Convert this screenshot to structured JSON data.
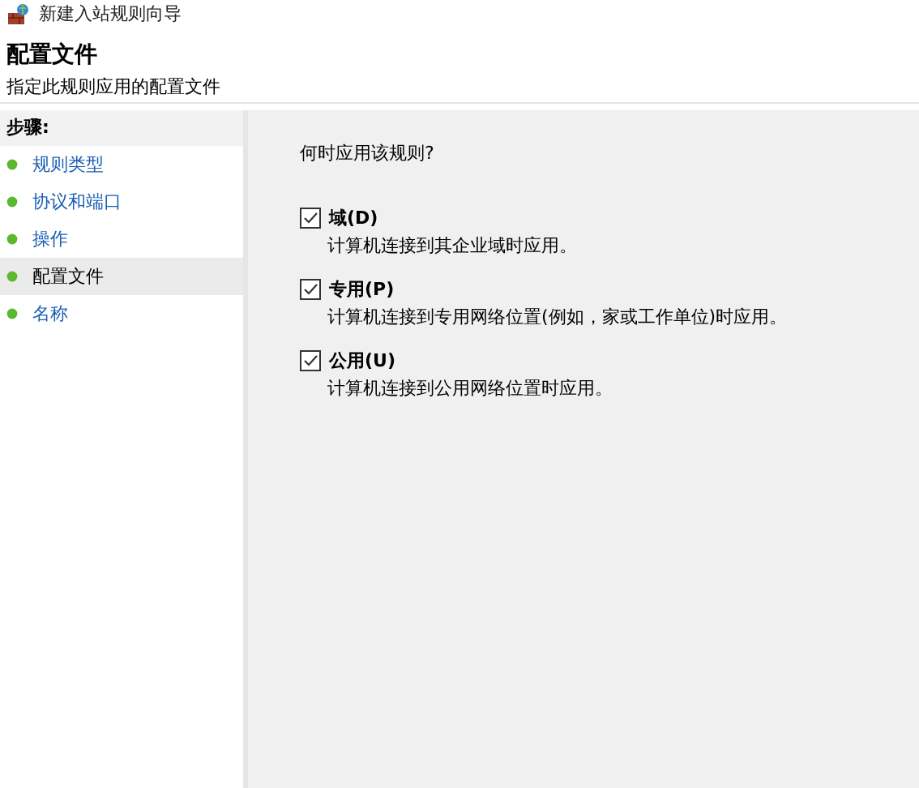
{
  "window": {
    "title": "新建入站规则向导"
  },
  "header": {
    "title": "配置文件",
    "subtitle": "指定此规则应用的配置文件"
  },
  "steps": {
    "heading": "步骤:",
    "items": [
      {
        "label": "规则类型",
        "selected": false
      },
      {
        "label": "协议和端口",
        "selected": false
      },
      {
        "label": "操作",
        "selected": false
      },
      {
        "label": "配置文件",
        "selected": true
      },
      {
        "label": "名称",
        "selected": false
      }
    ]
  },
  "content": {
    "question": "何时应用该规则?",
    "options": [
      {
        "label": "域(D)",
        "description": "计算机连接到其企业域时应用。",
        "checked": true
      },
      {
        "label": "专用(P)",
        "description": "计算机连接到专用网络位置(例如，家或工作单位)时应用。",
        "checked": true
      },
      {
        "label": "公用(U)",
        "description": "计算机连接到公用网络位置时应用。",
        "checked": true
      }
    ]
  }
}
